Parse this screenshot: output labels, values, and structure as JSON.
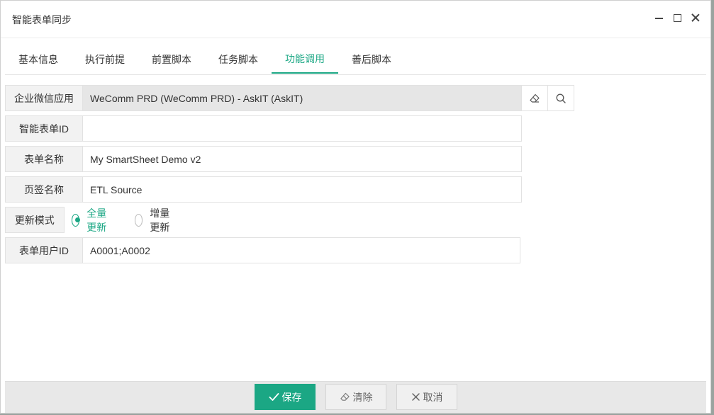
{
  "window": {
    "title": "智能表单同步"
  },
  "tabs": [
    {
      "label": "基本信息"
    },
    {
      "label": "执行前提"
    },
    {
      "label": "前置脚本"
    },
    {
      "label": "任务脚本"
    },
    {
      "label": "功能调用"
    },
    {
      "label": "善后脚本"
    }
  ],
  "form": {
    "app": {
      "label": "企业微信应用",
      "value": "WeComm PRD (WeComm PRD) - AskIT (AskIT)"
    },
    "sheet_id": {
      "label": "智能表单ID",
      "value": ""
    },
    "sheet_name": {
      "label": "表单名称",
      "value": "My SmartSheet Demo v2"
    },
    "tab_name": {
      "label": "页签名称",
      "value": "ETL Source"
    },
    "update_mode": {
      "label": "更新模式",
      "options": [
        "全量更新",
        "增量更新"
      ],
      "selected": "全量更新"
    },
    "user_ids": {
      "label": "表单用户ID",
      "value": "A0001;A0002"
    }
  },
  "footer": {
    "save": "保存",
    "clear": "清除",
    "cancel": "取消"
  },
  "colors": {
    "accent": "#1ba784"
  }
}
